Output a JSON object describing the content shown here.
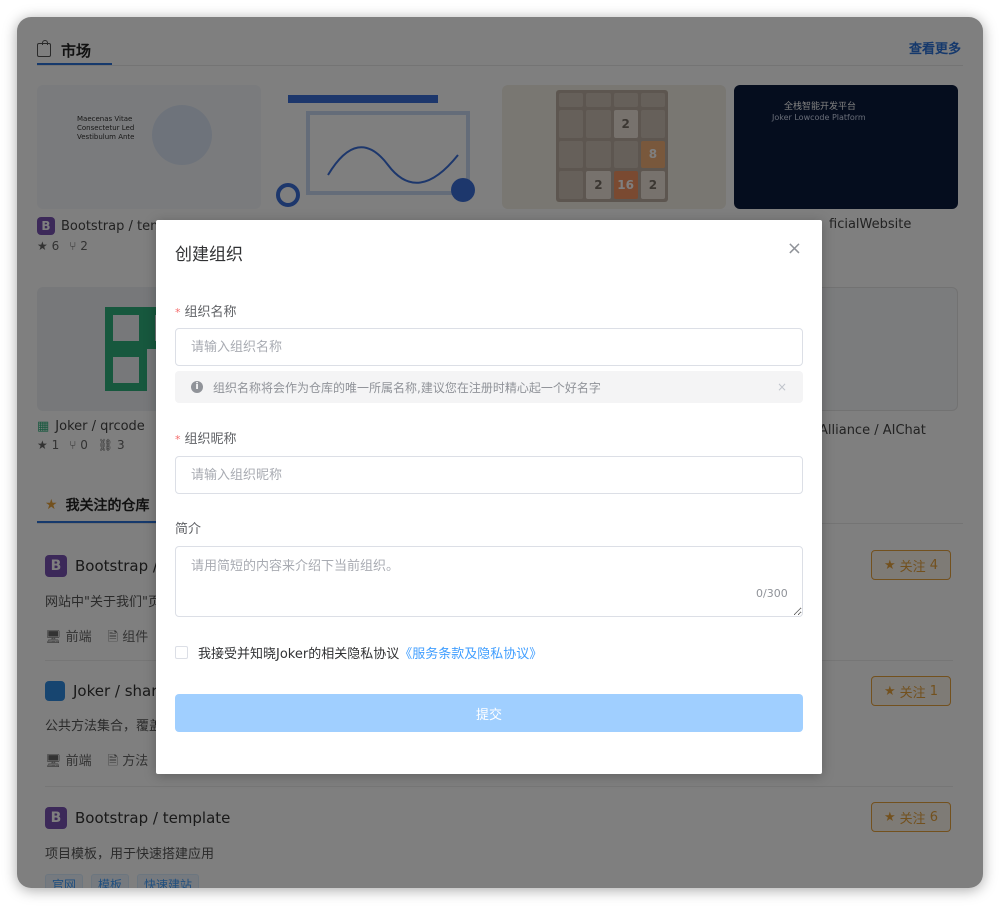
{
  "market": {
    "title": "市场",
    "see_more": "查看更多",
    "cards": [
      {
        "name": "Bootstrap / tem",
        "stars": "6",
        "forks": "2"
      },
      {
        "name": "",
        "stars": "",
        "forks": ""
      },
      {
        "name": "",
        "stars": "",
        "forks": ""
      },
      {
        "name": "ficialWebsite",
        "stars": "",
        "forks": ""
      },
      {
        "name": "Joker / qrcode",
        "stars": "1",
        "forks": "0",
        "links": "3"
      },
      {
        "name": "Alliance / AIChat"
      }
    ],
    "thumb_text": {
      "web": "Maecenas Vitae\nConsectetur Led\nVestibulum Ante",
      "dark_title": "全栈智能开发平台",
      "dark_sub": "Joker Lowcode Platform"
    },
    "tiles_2048": [
      "",
      "",
      "",
      "",
      "",
      "",
      "2",
      "",
      "",
      "",
      "",
      "8",
      "",
      "2",
      "16",
      "2"
    ]
  },
  "following": {
    "title": "我关注的仓库",
    "repos": [
      {
        "name": "Bootstrap / ",
        "desc": "网站中\"关于我们\"页",
        "tags": [
          "前端",
          "组件"
        ],
        "follow_label": "关注",
        "follow_count": "4"
      },
      {
        "name": "Joker / shar",
        "desc": "公共方法集合，覆盖",
        "tags": [
          "前端",
          "方法"
        ],
        "follow_label": "关注",
        "follow_count": "1"
      },
      {
        "name": "Bootstrap / template",
        "desc": "项目模板，用于快速搭建应用",
        "chips": [
          "官网",
          "模板",
          "快速建站"
        ],
        "follow_label": "关注",
        "follow_count": "6"
      }
    ]
  },
  "dialog": {
    "title": "创建组织",
    "org_name_label": "组织名称",
    "org_name_placeholder": "请输入组织名称",
    "org_name_hint": "组织名称将会作为仓库的唯一所属名称,建议您在注册时精心起一个好名字",
    "nickname_label": "组织昵称",
    "nickname_placeholder": "请输入组织昵称",
    "intro_label": "简介",
    "intro_placeholder": "请用简短的内容来介绍下当前组织。",
    "intro_counter": "0/300",
    "agree_text": "我接受并知晓Joker的相关隐私协议",
    "agree_link": "《服务条款及隐私协议》",
    "submit_label": "提交",
    "required_mark": "*",
    "close_glyph": "×",
    "hint_close_glyph": "×"
  },
  "colors": {
    "accent": "#2d72d9",
    "primary": "#409eff",
    "primary_disabled": "#a0cfff",
    "warning": "#e6a23c",
    "bootstrap": "#7952b3"
  }
}
